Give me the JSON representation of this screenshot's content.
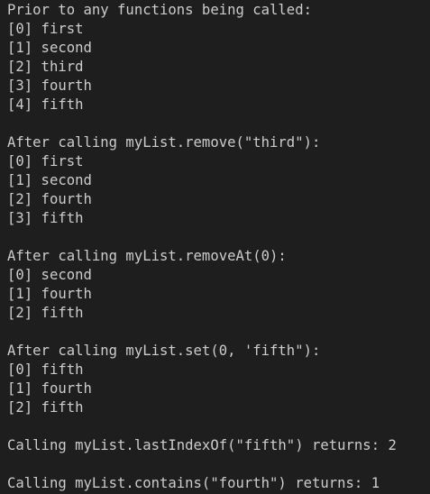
{
  "terminal": {
    "lines": [
      "Prior to any functions being called:",
      "[0] first",
      "[1] second",
      "[2] third",
      "[3] fourth",
      "[4] fifth",
      "",
      "After calling myList.remove(\"third\"):",
      "[0] first",
      "[1] second",
      "[2] fourth",
      "[3] fifth",
      "",
      "After calling myList.removeAt(0):",
      "[0] second",
      "[1] fourth",
      "[2] fifth",
      "",
      "After calling myList.set(0, 'fifth\"):",
      "[0] fifth",
      "[1] fourth",
      "[2] fifth",
      "",
      "Calling myList.lastIndexOf(\"fifth\") returns: 2",
      "",
      "Calling myList.contains(\"fourth\") returns: 1"
    ]
  },
  "colors": {
    "background": "#1e1e1e",
    "text": "#cccccc"
  }
}
